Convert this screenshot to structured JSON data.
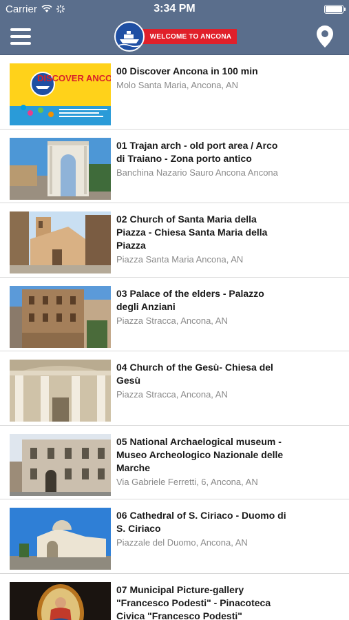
{
  "status_bar": {
    "carrier": "Carrier",
    "time": "3:34 PM"
  },
  "header": {
    "logo_text": "WELCOME TO ANCONA",
    "bar_color": "#5a6e8c",
    "accent_color": "#e0202a"
  },
  "icons": {
    "menu": "hamburger-menu-icon",
    "map": "map-pin-icon"
  },
  "items": [
    {
      "title": "00 Discover Ancona in 100 min",
      "subtitle": "Molo Santa Maria, Ancona, AN",
      "thumb_text": "DISCOVER ANCONA"
    },
    {
      "title": "01 Trajan arch - old port area / Arco di Traiano  - Zona porto antico",
      "subtitle": "Banchina Nazario Sauro Ancona Ancona"
    },
    {
      "title": "02 Church of Santa Maria della Piazza - Chiesa Santa Maria della Piazza",
      "subtitle": "Piazza Santa Maria Ancona, AN"
    },
    {
      "title": " 03 Palace  of the elders - Palazzo degli Anziani",
      "subtitle": "Piazza Stracca, Ancona, AN"
    },
    {
      "title": "04 Church of the Gesù- Chiesa del Gesù",
      "subtitle": "Piazza Stracca, Ancona, AN"
    },
    {
      "title": "05 National  Archaelogical museum - Museo Archeologico Nazionale delle Marche",
      "subtitle": "Via Gabriele Ferretti, 6, Ancona, AN"
    },
    {
      "title": "06 Cathedral of S. Ciriaco - Duomo di S. Ciriaco",
      "subtitle": "Piazzale del Duomo, Ancona, AN"
    },
    {
      "title": "07 Municipal Picture-gallery \"Francesco Podesti\" - Pinacoteca Civica \"Francesco Podesti\"",
      "subtitle": ""
    }
  ]
}
